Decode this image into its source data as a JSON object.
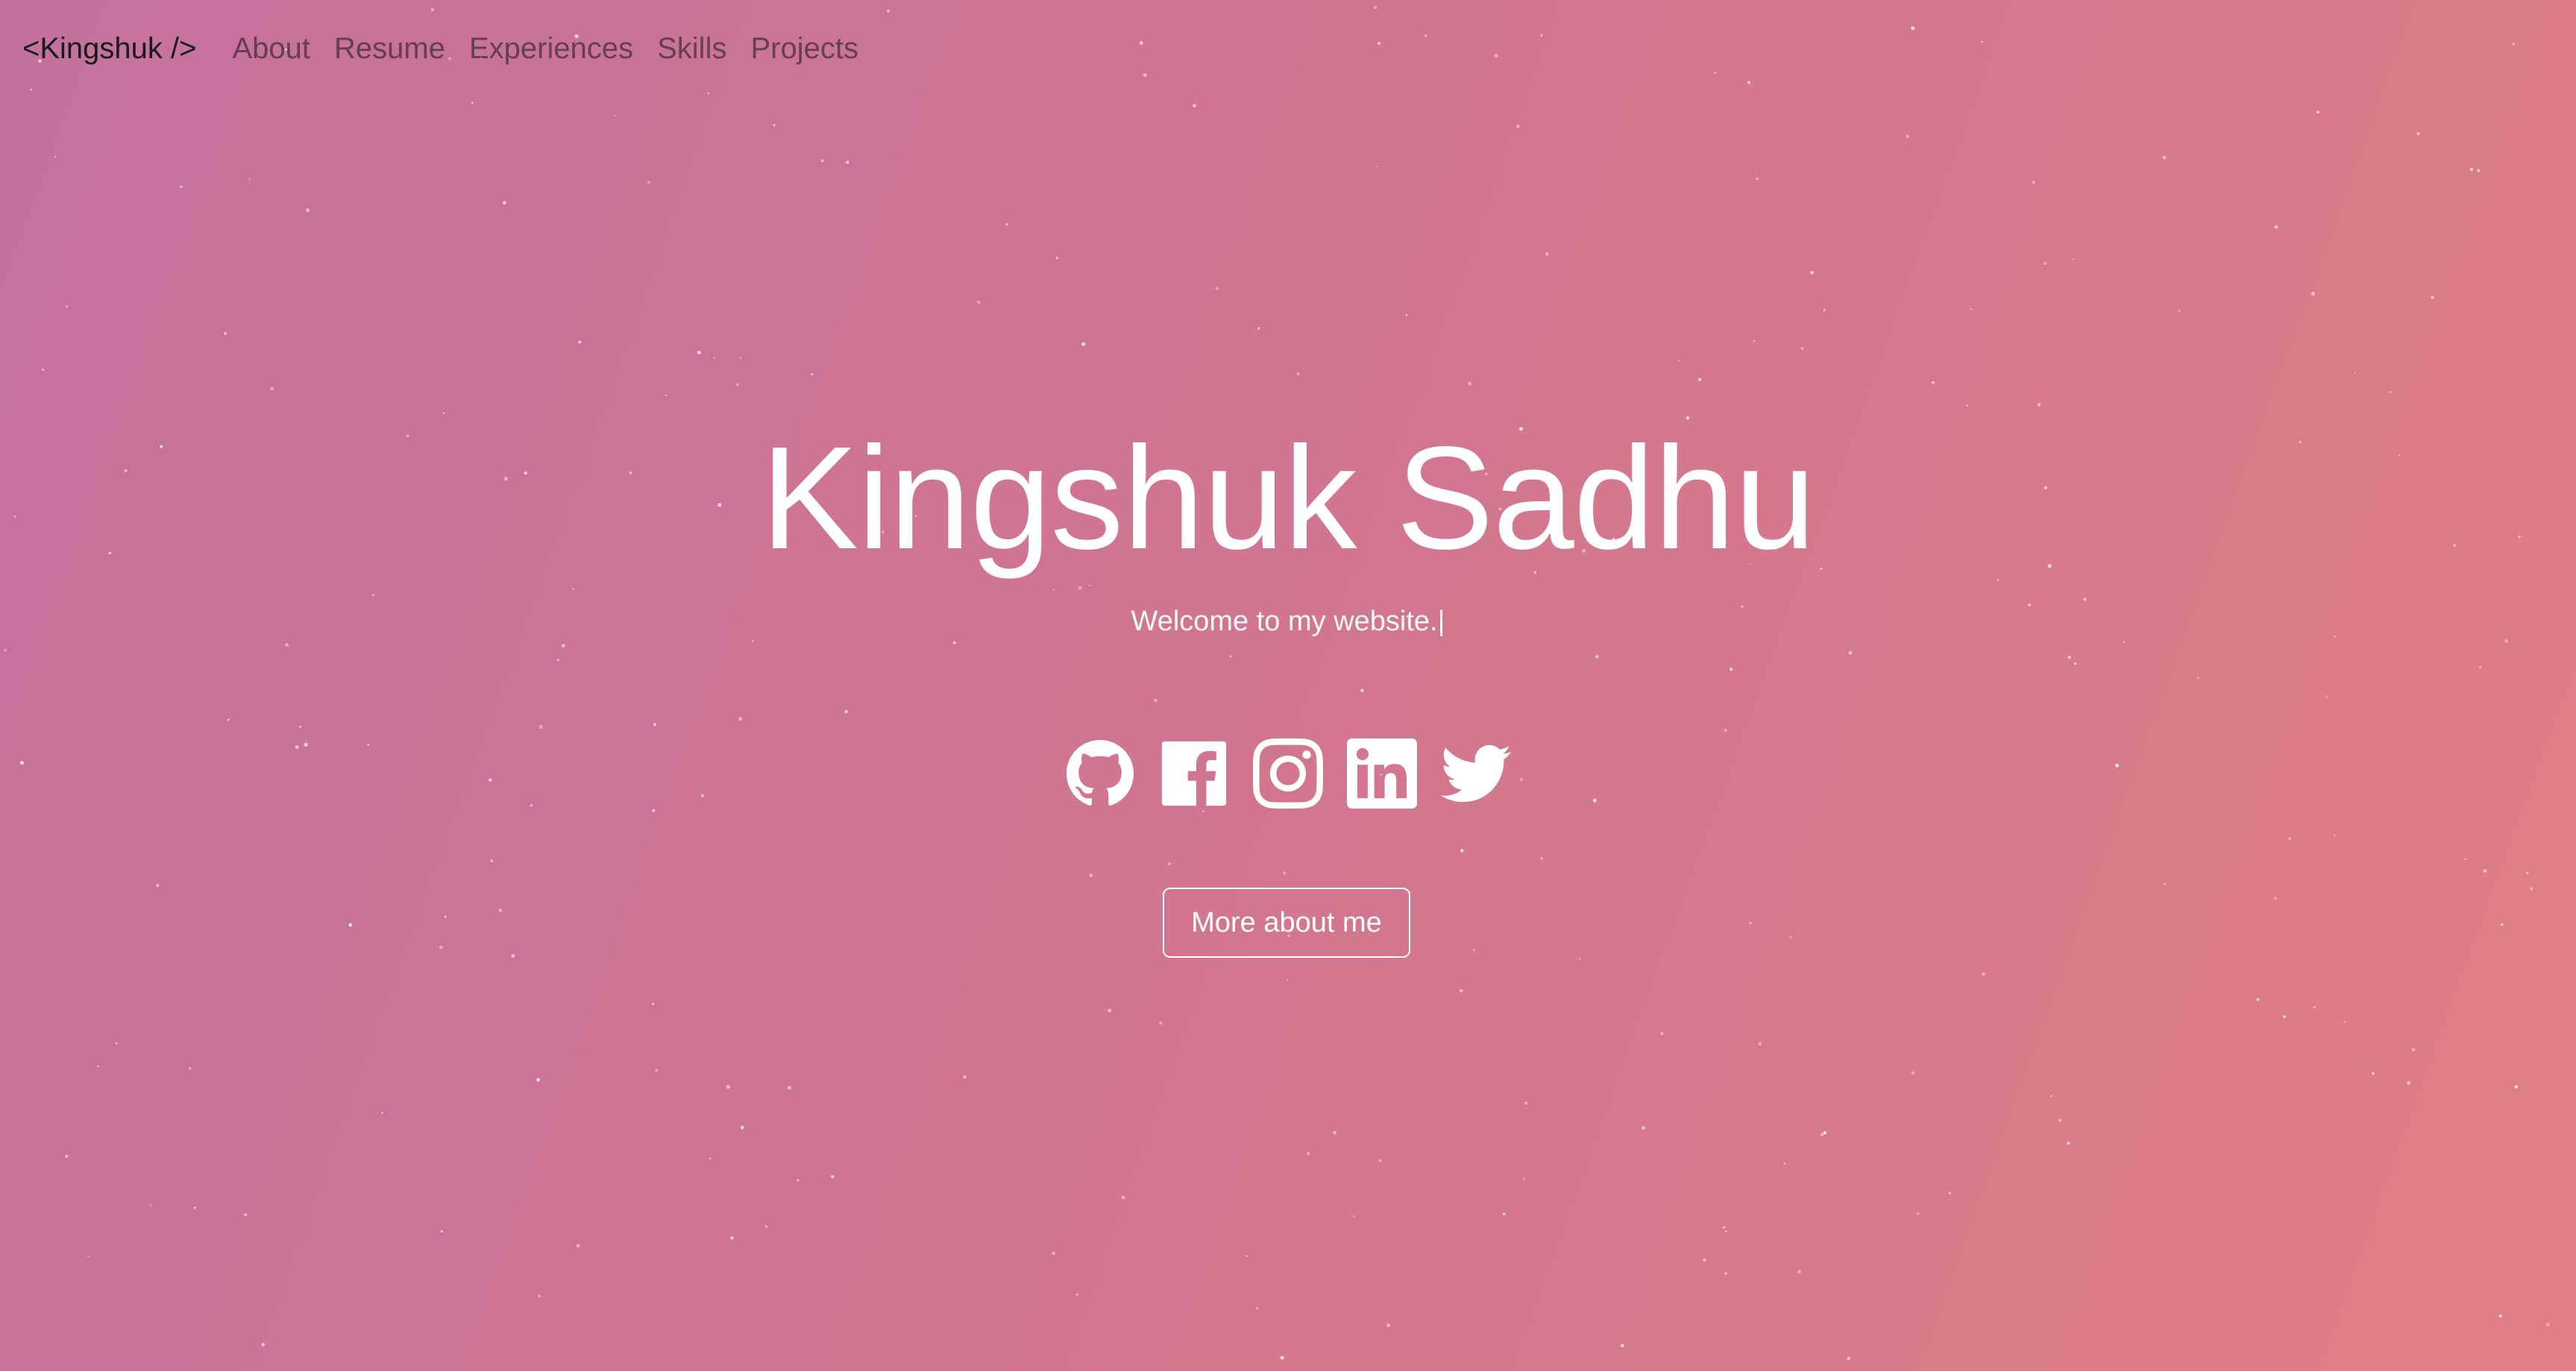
{
  "navbar": {
    "brand": "<Kingshuk />",
    "links": [
      "About",
      "Resume",
      "Experiences",
      "Skills",
      "Projects"
    ]
  },
  "hero": {
    "name": "Kingshuk Sadhu",
    "tagline": "Welcome to my website.|",
    "cta_label": "More about me"
  },
  "socials": [
    {
      "icon": "github-icon",
      "label": "GitHub"
    },
    {
      "icon": "facebook-icon",
      "label": "Facebook"
    },
    {
      "icon": "instagram-icon",
      "label": "Instagram"
    },
    {
      "icon": "linkedin-icon",
      "label": "LinkedIn"
    },
    {
      "icon": "twitter-icon",
      "label": "Twitter"
    }
  ],
  "colors": {
    "background_start": "#c4719e",
    "background_end": "#e07f85",
    "text": "#ffffff",
    "brand": "#1a1a1a"
  }
}
